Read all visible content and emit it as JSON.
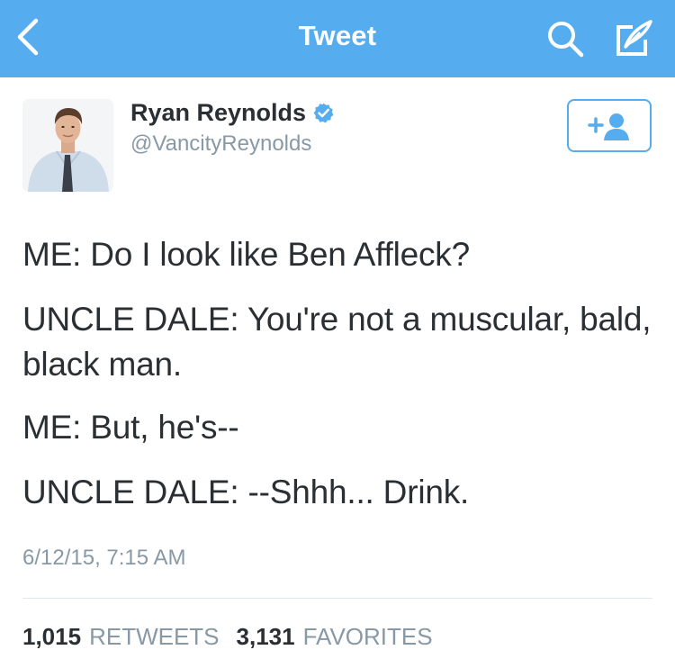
{
  "navbar": {
    "title": "Tweet",
    "back_icon": "chevron-left-icon",
    "search_icon": "search-icon",
    "compose_icon": "compose-tweet-icon",
    "background_color": "#55ACEE"
  },
  "tweet": {
    "author": {
      "display_name": "Ryan Reynolds",
      "handle": "@VancityReynolds",
      "verified": true,
      "verified_icon": "verified-badge-icon"
    },
    "follow_button_icon": "add-user-icon",
    "lines": [
      "ME: Do I look like Ben Affleck?",
      "UNCLE DALE: You're not a muscular, bald, black man.",
      "ME: But, he's--",
      "UNCLE DALE: --Shhh... Drink."
    ],
    "timestamp": "6/12/15, 7:15 AM",
    "retweets": {
      "count": "1,015",
      "label": "RETWEETS"
    },
    "favorites": {
      "count": "3,131",
      "label": "FAVORITES"
    }
  },
  "colors": {
    "accent": "#55ACEE",
    "text_primary": "#292F33",
    "text_secondary": "#8899A6",
    "divider": "#E1E8ED"
  }
}
